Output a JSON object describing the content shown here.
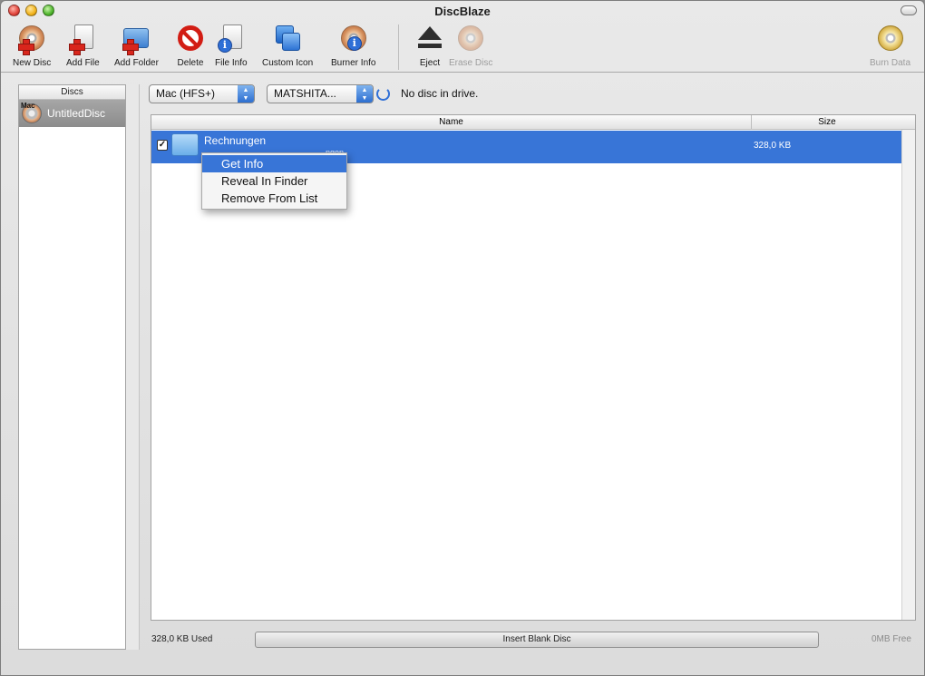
{
  "window": {
    "title": "DiscBlaze"
  },
  "toolbar": {
    "new_disc": "New Disc",
    "add_file": "Add File",
    "add_folder": "Add Folder",
    "delete": "Delete",
    "file_info": "File Info",
    "custom_icon": "Custom Icon",
    "burner_info": "Burner Info",
    "eject": "Eject",
    "erase_disc": "Erase Disc",
    "burn_data": "Burn Data"
  },
  "sidebar": {
    "header": "Discs",
    "items": [
      {
        "label": "UntitledDisc",
        "badge": "Mac"
      }
    ]
  },
  "controls": {
    "format_popup": "Mac (HFS+)",
    "drive_popup": "MATSHITA...",
    "drive_status": "No disc in drive."
  },
  "table": {
    "columns": [
      "Name",
      "Size"
    ],
    "rows": [
      {
        "name": "Rechnungen",
        "path": "/Users/Desktop/Rechnungen",
        "path_visible_tail": "ngen",
        "size": "328,0 KB",
        "checked": true
      }
    ]
  },
  "context_menu": {
    "items": [
      "Get Info",
      "Reveal In Finder",
      "Remove From List"
    ],
    "highlighted_index": 0
  },
  "footer": {
    "used": "328,0 KB Used",
    "insert_button": "Insert Blank Disc",
    "free": "0MB Free"
  },
  "colors": {
    "selection": "#3875d7",
    "window_bg": "#e3e3e3"
  }
}
